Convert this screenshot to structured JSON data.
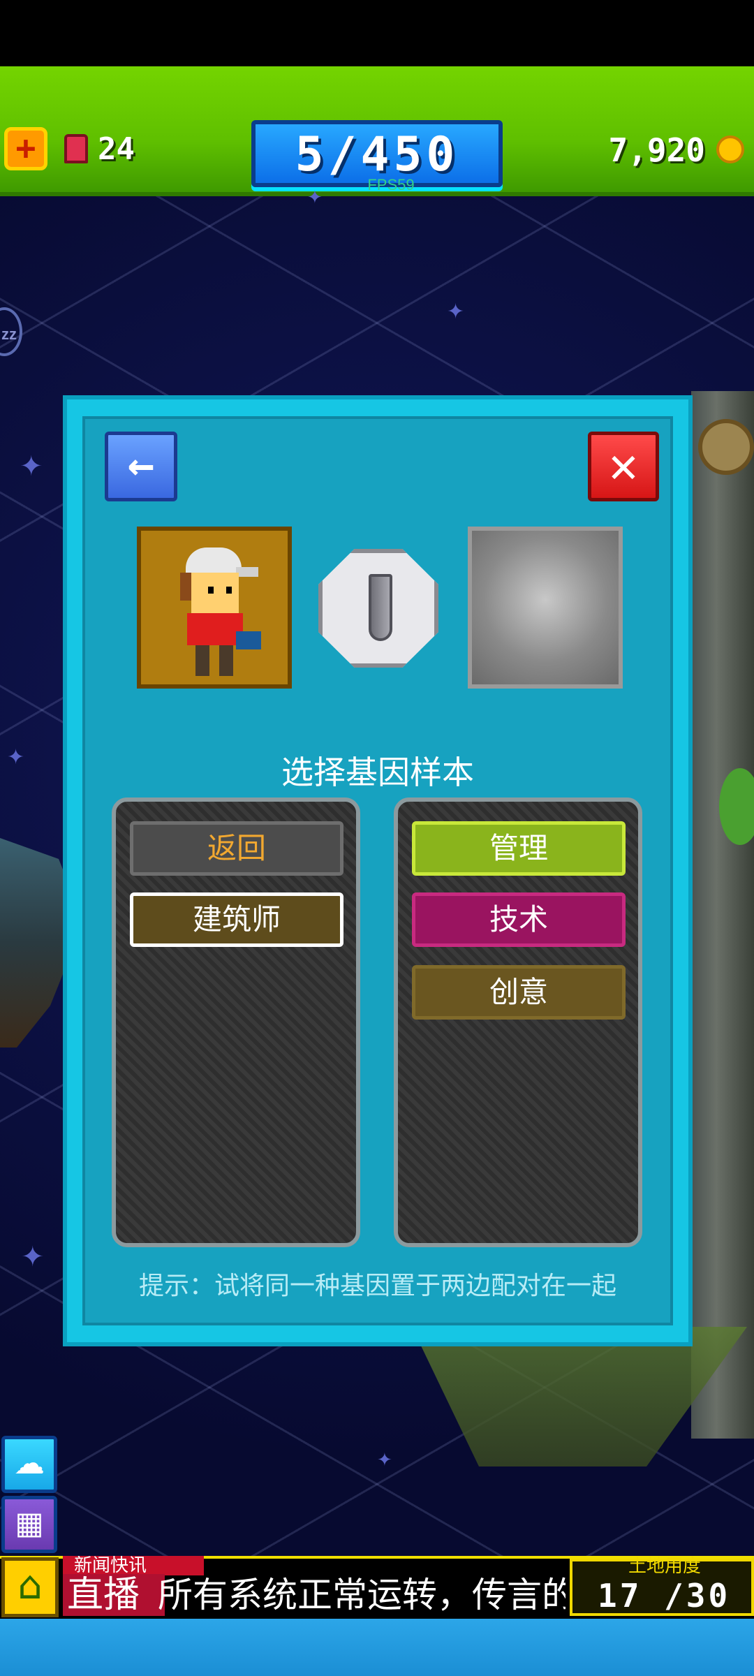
{
  "resources": {
    "tickets": "24",
    "population": "5/450",
    "fps": "FPS59",
    "coins": "7,920"
  },
  "icons": {
    "medkit": "medkit-icon",
    "ticket": "ticket-icon",
    "coin": "coin-icon",
    "back": "arrow-left-icon",
    "close": "close-icon",
    "vial": "test-tube-icon",
    "cloud": "cloud-upload-icon",
    "calendar": "calendar-icon",
    "home": "home-icon"
  },
  "modal": {
    "title": "选择基因样本",
    "left_panel": {
      "back_label": "返回",
      "items": [
        "建筑师"
      ]
    },
    "right_panel": {
      "items": [
        "管理",
        "技术",
        "创意"
      ]
    },
    "hint": "提示：试将同一种基因置于两边配对在一起"
  },
  "news": {
    "label": "新闻快讯",
    "live": "直播",
    "ticker": "所有系统正常运转，传言的"
  },
  "land": {
    "label": "土地用度",
    "value": "17 /30"
  },
  "colors": {
    "resource_bar": "#5fbf00",
    "modal_bg": "#16c6e4",
    "manage": "#8ab41c",
    "tech": "#9a1460",
    "creative": "#6a5620",
    "architect": "#5e4c1c"
  }
}
